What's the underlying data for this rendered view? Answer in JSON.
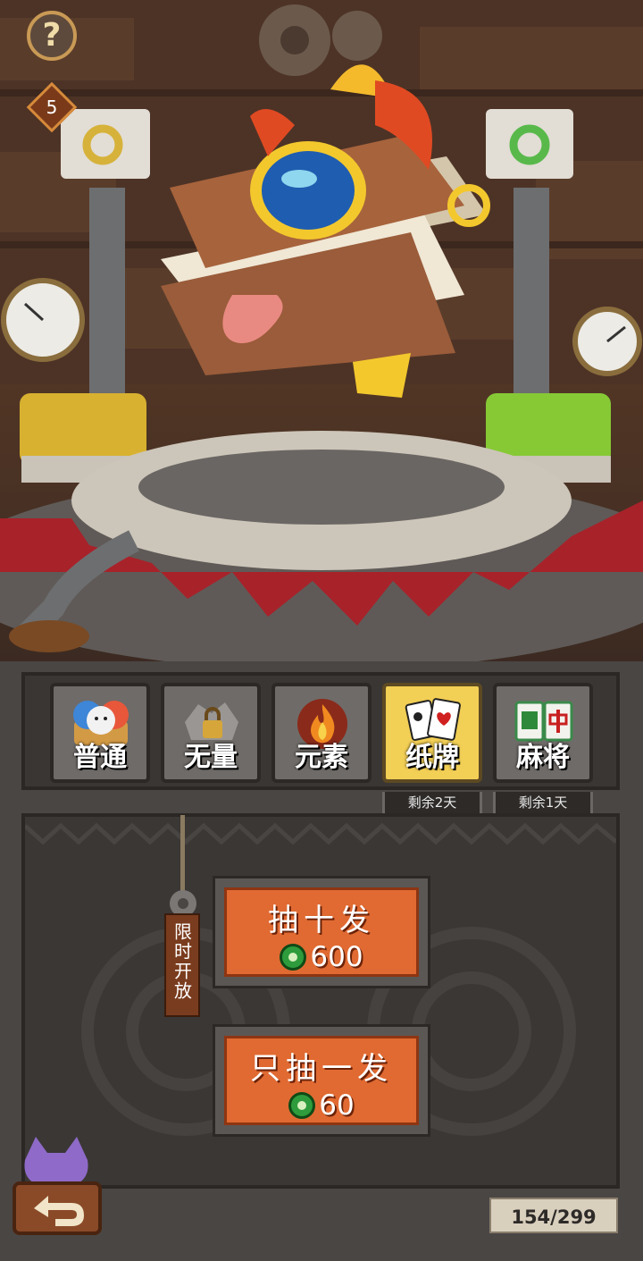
{
  "hud": {
    "help_label": "?",
    "level": "5"
  },
  "tabs": [
    {
      "label": "普通",
      "icon": "mouse-mask-icon",
      "active": false
    },
    {
      "label": "无量",
      "icon": "locked-icon",
      "active": false
    },
    {
      "label": "元素",
      "icon": "fire-icon",
      "active": false
    },
    {
      "label": "纸牌",
      "icon": "playing-cards-icon",
      "active": true
    },
    {
      "label": "麻将",
      "icon": "mahjong-tiles-icon",
      "active": false
    }
  ],
  "remaining": [
    "剩余2天",
    "剩余1天"
  ],
  "limited_label": "限时开放",
  "draw_ten": {
    "title": "抽十发",
    "cost": "600"
  },
  "draw_one": {
    "title": "只抽一发",
    "cost": "60"
  },
  "inventory_count": "154/299",
  "colors": {
    "accent_orange": "#e06a32",
    "active_tab": "#f2cf55",
    "coin_green": "#2e9c3c"
  }
}
